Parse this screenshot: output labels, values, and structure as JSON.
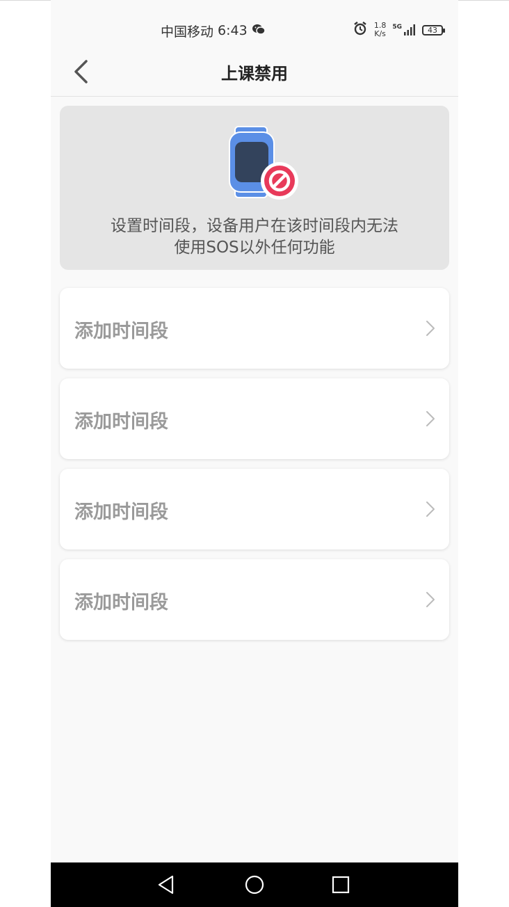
{
  "status_bar": {
    "carrier": "中国移动",
    "time": "6:43",
    "net_speed_value": "1.8",
    "net_speed_unit": "K/s",
    "signal_label": "5G",
    "battery": "43"
  },
  "header": {
    "title": "上课禁用"
  },
  "info": {
    "line1": "设置时间段，设备用户在该时间段内无法",
    "line2": "使用SOS以外任何功能"
  },
  "slots": [
    {
      "label": "添加时间段"
    },
    {
      "label": "添加时间段"
    },
    {
      "label": "添加时间段"
    },
    {
      "label": "添加时间段"
    }
  ],
  "colors": {
    "watch_blue": "#5b8fe6",
    "watch_screen": "#33435c",
    "forbid_red": "#e83a5a",
    "card_bg": "#e5e5e5"
  }
}
